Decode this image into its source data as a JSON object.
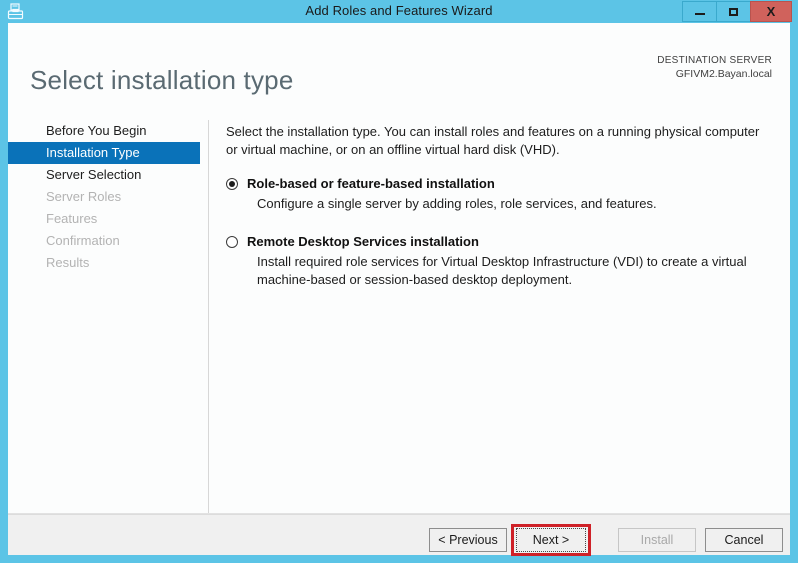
{
  "window": {
    "title": "Add Roles and Features Wizard",
    "icon": "server-wizard-icon",
    "accent_color": "#5cc4e6",
    "controls": {
      "minimize_label": "Minimize",
      "maximize_label": "Maximize",
      "close_label": "X"
    }
  },
  "header": {
    "page_title": "Select installation type",
    "destination_label": "DESTINATION SERVER",
    "destination_value": "GFIVM2.Bayan.local"
  },
  "sidebar": {
    "items": [
      {
        "label": "Before You Begin",
        "state": "enabled"
      },
      {
        "label": "Installation Type",
        "state": "selected"
      },
      {
        "label": "Server Selection",
        "state": "enabled"
      },
      {
        "label": "Server Roles",
        "state": "disabled"
      },
      {
        "label": "Features",
        "state": "disabled"
      },
      {
        "label": "Confirmation",
        "state": "disabled"
      },
      {
        "label": "Results",
        "state": "disabled"
      }
    ],
    "selected_color": "#0a72b9"
  },
  "main": {
    "intro": "Select the installation type. You can install roles and features on a running physical computer or virtual machine, or on an offline virtual hard disk (VHD).",
    "options": [
      {
        "label": "Role-based or feature-based installation",
        "description": "Configure a single server by adding roles, role services, and features.",
        "selected": true
      },
      {
        "label": "Remote Desktop Services installation",
        "description": "Install required role services for Virtual Desktop Infrastructure (VDI) to create a virtual machine-based or session-based desktop deployment.",
        "selected": false
      }
    ]
  },
  "footer": {
    "previous_label": "< Previous",
    "next_label": "Next >",
    "install_label": "Install",
    "cancel_label": "Cancel",
    "install_disabled": true,
    "highlight_color": "#cf2128",
    "highlighted_button": "Next >"
  }
}
